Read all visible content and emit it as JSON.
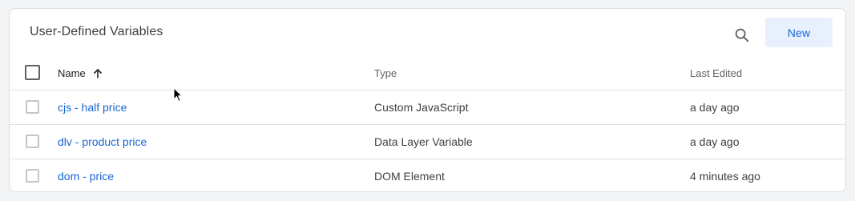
{
  "card": {
    "title": "User-Defined Variables",
    "new_label": "New"
  },
  "table": {
    "columns": {
      "name": "Name",
      "type": "Type",
      "last_edited": "Last Edited"
    },
    "sort": {
      "column": "name",
      "direction": "ascending",
      "icon": "arrow-up-icon"
    },
    "rows": [
      {
        "name": "cjs - half price",
        "type": "Custom JavaScript",
        "last_edited": "a day ago"
      },
      {
        "name": "dlv - product price",
        "type": "Data Layer Variable",
        "last_edited": "a day ago"
      },
      {
        "name": "dom - price",
        "type": "DOM Element",
        "last_edited": "4 minutes ago"
      }
    ]
  },
  "colors": {
    "link": "#1967d2",
    "new_button_bg": "#e8f0fe",
    "text": "#3c4043",
    "border": "#dadce0"
  },
  "icons": {
    "search": "search-icon",
    "sort": "arrow-up-icon"
  }
}
